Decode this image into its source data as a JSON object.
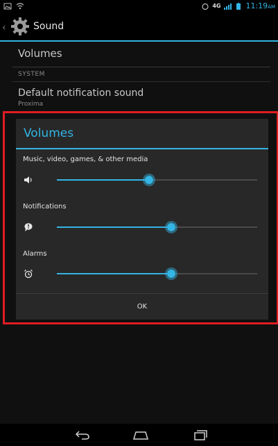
{
  "status_bar": {
    "network_label": "4G",
    "time": "11:19",
    "ampm": "AM",
    "icons": [
      "image-notification-icon",
      "wifi-icon",
      "signal-icon",
      "battery-icon"
    ]
  },
  "action_bar": {
    "title": "Sound",
    "app_icon": "gear-icon",
    "up_icon": "chevron-left-icon"
  },
  "settings": {
    "volumes_label": "Volumes",
    "section_system": "SYSTEM",
    "default_notification_label": "Default notification sound",
    "default_notification_value": "Proxima"
  },
  "dialog": {
    "title": "Volumes",
    "accent": "#33b5e5",
    "rows": [
      {
        "label": "Music, video, games, & other media",
        "icon": "speaker-icon",
        "level": 0.46
      },
      {
        "label": "Notifications",
        "icon": "notification-bubble-icon",
        "level": 0.57
      },
      {
        "label": "Alarms",
        "icon": "alarm-clock-icon",
        "level": 0.57
      }
    ],
    "ok_label": "OK"
  },
  "highlight_color": "#e01c22",
  "navigation": {
    "icons": [
      "back-icon",
      "home-icon",
      "recents-icon"
    ]
  }
}
